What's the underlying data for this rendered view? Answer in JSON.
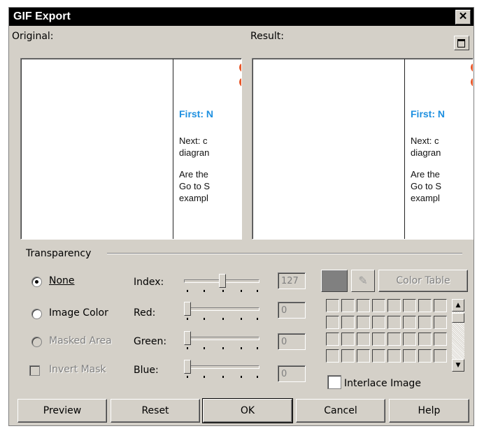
{
  "window": {
    "title": "GIF Export",
    "close_glyph": "✕"
  },
  "preview": {
    "original_label": "Original:",
    "result_label": "Result:",
    "content_heading": "First: N",
    "content_lines": [
      "Next: c",
      "diagran",
      "Are the",
      "Go to S",
      "exampl"
    ]
  },
  "transparency": {
    "group_label": "Transparency",
    "modes": [
      {
        "label": "None",
        "selected": true,
        "enabled": true
      },
      {
        "label": "Image Color",
        "selected": false,
        "enabled": true
      },
      {
        "label": "Masked Area",
        "selected": false,
        "enabled": false
      }
    ],
    "invert_mask": {
      "label": "Invert Mask",
      "checked": false,
      "enabled": false
    },
    "sliders": [
      {
        "label": "Index:",
        "value": "127",
        "level": 0.5
      },
      {
        "label": "Red:",
        "value": "0",
        "level": 0
      },
      {
        "label": "Green:",
        "value": "0",
        "level": 0
      },
      {
        "label": "Blue:",
        "value": "0",
        "level": 0
      }
    ],
    "selected_color": "#808080",
    "color_table_label": "Color Table",
    "interlace": {
      "label": "Interlace Image",
      "checked": false
    }
  },
  "buttons": {
    "preview": "Preview",
    "reset": "Reset",
    "ok": "OK",
    "cancel": "Cancel",
    "help": "Help"
  },
  "colors": {
    "accent_blue": "#1e90e0",
    "logo_orange": "#e8582a",
    "dialog_face": "#d4d0c8"
  }
}
